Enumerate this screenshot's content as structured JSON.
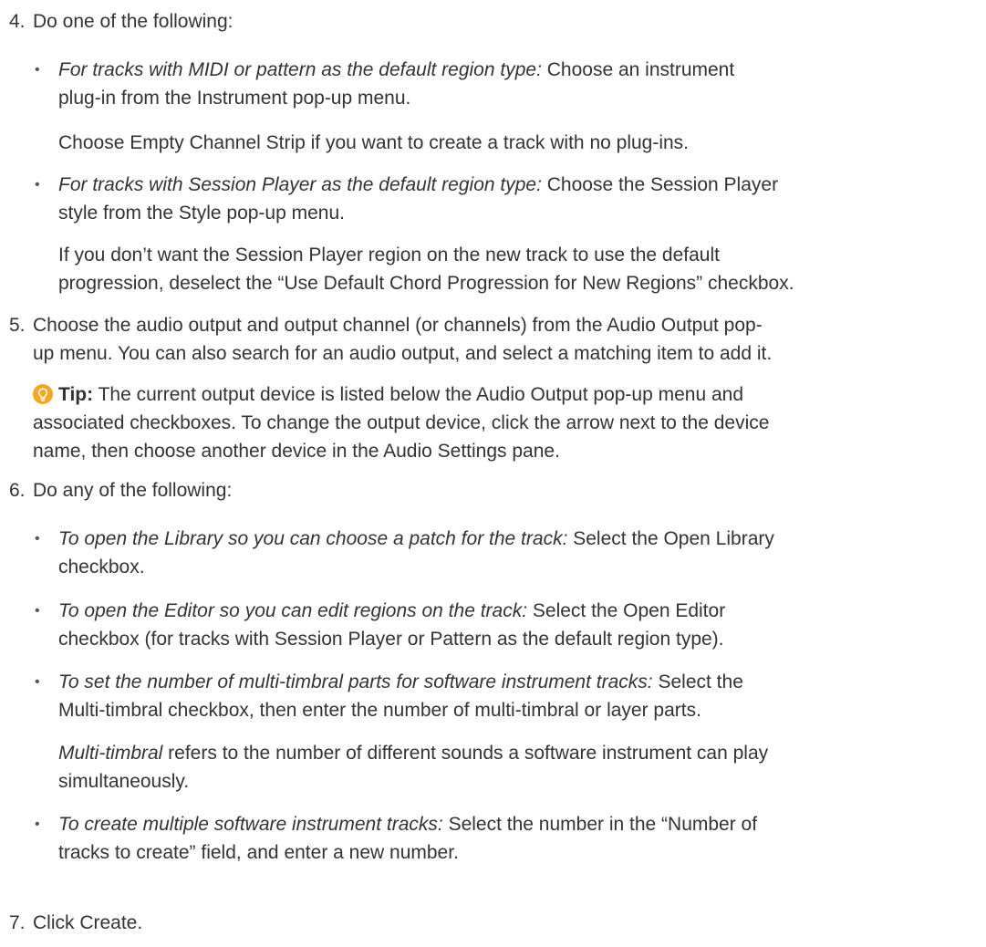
{
  "step4": {
    "num": "4.",
    "text": "Do one of the following:",
    "b1_em": "For tracks with MIDI or pattern as the default region type:",
    "b1_rest_l1": " Choose an instrument",
    "b1_l2": "plug-in from the Instrument pop-up menu.",
    "b1_sub": "Choose Empty Channel Strip if you want to create a track with no plug-ins.",
    "b2_em": "For tracks with Session Player as the default region type:",
    "b2_rest_l1": " Choose the Session Player",
    "b2_l2": "style from the Style pop-up menu.",
    "b2_sub_l1": "If you don’t want the Session Player region on the new track to use the default",
    "b2_sub_l2": "progression, deselect the “Use Default Chord Progression for New Regions” checkbox."
  },
  "step5": {
    "num": "5.",
    "l1": "Choose the audio output and output channel (or channels) from the Audio Output pop-",
    "l2": "up menu. You can also search for an audio output, and select a matching item to add it.",
    "tip_label": "Tip:",
    "tip_l1": " The current output device is listed below the Audio Output pop-up menu and",
    "tip_l2": "associated checkboxes. To change the output device, click the arrow next to the device",
    "tip_l3": "name, then choose another device in the Audio Settings pane.",
    "tip_color": "#f5a623"
  },
  "step6": {
    "num": "6.",
    "text": "Do any of the following:",
    "b1_em": "To open the Library so you can choose a patch for the track:",
    "b1_rest_l1": " Select the Open Library",
    "b1_l2": "checkbox.",
    "b2_em": "To open the Editor so you can edit regions on the track:",
    "b2_rest_l1": " Select the Open Editor",
    "b2_l2": "checkbox (for tracks with Session Player or Pattern as the default region type).",
    "b3_em": "To set the number of multi-timbral parts for software instrument tracks:",
    "b3_rest_l1": " Select the",
    "b3_l2": "Multi-timbral checkbox, then enter the number of multi-timbral or layer parts.",
    "b3_sub_em": "Multi-timbral",
    "b3_sub_rest_l1": " refers to the number of different sounds a software instrument can play",
    "b3_sub_l2": "simultaneously.",
    "b4_em": "To create multiple software instrument tracks:",
    "b4_rest_l1": " Select the number in the “Number of",
    "b4_l2": "tracks to create” field, and enter a new number."
  },
  "step7": {
    "num": "7.",
    "text": "Click Create."
  },
  "bullet_char": "•"
}
